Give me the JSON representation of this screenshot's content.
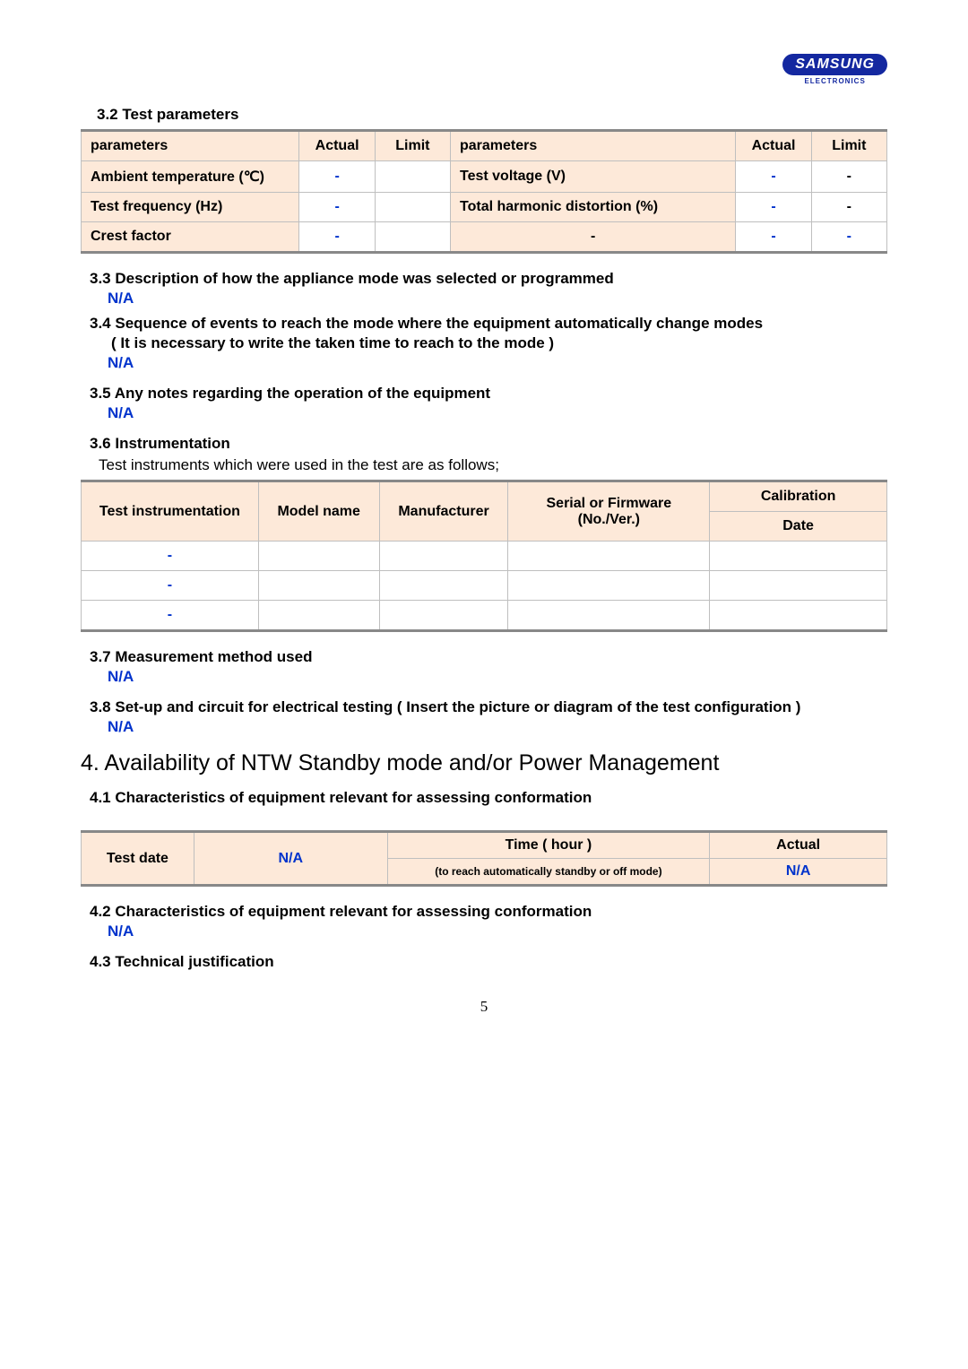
{
  "logo": {
    "main": "SAMSUNG",
    "sub": "ELECTRONICS"
  },
  "s32": {
    "title": "3.2 Test parameters",
    "h_param": "parameters",
    "h_actual": "Actual",
    "h_limit": "Limit",
    "rows": [
      {
        "p1": "Ambient temperature (℃)",
        "a1": "-",
        "l1": "",
        "p2": "Test voltage (V)",
        "a2": "-",
        "l2": "-"
      },
      {
        "p1": "Test frequency (Hz)",
        "a1": "-",
        "l1": "",
        "p2": "Total harmonic distortion (%)",
        "a2": "-",
        "l2": "-"
      },
      {
        "p1": "Crest factor",
        "a1": "-",
        "l1": "",
        "p2": "-",
        "a2": "-",
        "l2": "-"
      }
    ]
  },
  "s33": {
    "title": "3.3 Description of how the appliance mode was selected or programmed",
    "val": "N/A"
  },
  "s34": {
    "title": "3.4 Sequence of events to reach the mode where the equipment automatically change modes",
    "sub": "( It is necessary to write the taken time to reach to the mode )",
    "val": "N/A"
  },
  "s35": {
    "title": "3.5 Any notes regarding the operation of the equipment",
    "val": "N/A"
  },
  "s36": {
    "title": "3.6 Instrumentation",
    "desc": "Test instruments which were used in the test are as follows;",
    "h1": "Test instrumentation",
    "h2": "Model name",
    "h3": "Manufacturer",
    "h4": "Serial or Firmware (No./Ver.)",
    "h5a": "Calibration",
    "h5b": "Date",
    "rows": [
      "-",
      "-",
      "-"
    ]
  },
  "s37": {
    "title": "3.7 Measurement method used",
    "val": "N/A"
  },
  "s38": {
    "title": "3.8 Set-up and circuit for electrical testing ( Insert the picture or diagram of the test configuration )",
    "val": "N/A"
  },
  "s4": {
    "title": "4. Availability of NTW Standby mode and/or Power Management"
  },
  "s41": {
    "title": "4.1 Characteristics of equipment relevant for assessing conformation",
    "c1": "Test date",
    "c2": "N/A",
    "c3a": "Time ( hour )",
    "c3b": "(to reach automatically standby or off mode)",
    "c4a": "Actual",
    "c4b": "N/A"
  },
  "s42": {
    "title": "4.2 Characteristics of equipment relevant for assessing conformation",
    "val": "N/A"
  },
  "s43": {
    "title": "4.3 Technical justification"
  },
  "page": "5"
}
